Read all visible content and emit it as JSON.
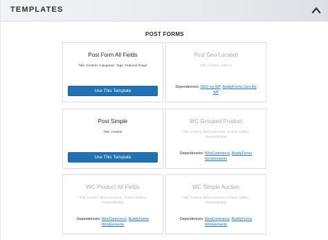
{
  "header": {
    "title": "TEMPLATES",
    "collapse_icon": "chevron-up-icon"
  },
  "section": {
    "title": "POST FORMS"
  },
  "cards": [
    {
      "title": "Post Form All Fields",
      "fields": "Title, Content, Categories, Tags, Featured Image",
      "button_label": "Use This Template",
      "enabled": true
    },
    {
      "title": "Post Geo Located",
      "fields": "Title, Content, Address",
      "dependencies_label": "Dependencies:",
      "dependencies": [
        "GEO my WP",
        "BuddyForms Geo My WP"
      ],
      "enabled": false
    },
    {
      "title": "Post Simple",
      "fields": "Title, Content",
      "button_label": "Use This Template",
      "enabled": true
    },
    {
      "title": "WC Grouped Product",
      "fields": "Title, Content, WooCommerce, Product Gallery, FeaturedImage",
      "dependencies_label": "Dependencies:",
      "dependencies": [
        "WooCommerce",
        "BuddyForms",
        "WooElements"
      ],
      "enabled": false
    },
    {
      "title": "WC Product All Fields",
      "fields": "Title, Content, WooCommerce, Product Gallery, FeaturedImage",
      "dependencies_label": "Dependencies:",
      "dependencies": [
        "WooCommerce",
        "BuddyForms",
        "WooElements"
      ],
      "enabled": false
    },
    {
      "title": "WC Simple Auction",
      "fields": "Title, Content, WooCommerce, Product Gallery, FeaturedImage",
      "dependencies_label": "Dependencies:",
      "dependencies": [
        "WooCommerce",
        "BuddyForms",
        "WooElements"
      ],
      "enabled": false
    }
  ],
  "colors": {
    "primary_button": "#2271b1",
    "link": "#2271b1",
    "disabled_text": "#a7aaad"
  }
}
